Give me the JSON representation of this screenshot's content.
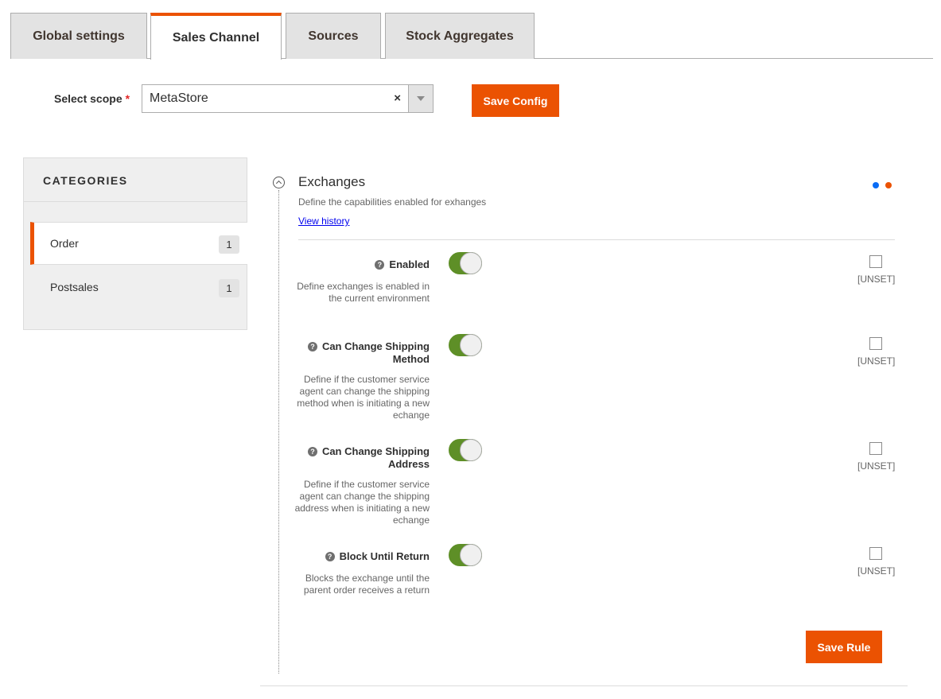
{
  "tabs": [
    {
      "label": "Global settings",
      "active": false
    },
    {
      "label": "Sales Channel",
      "active": true
    },
    {
      "label": "Sources",
      "active": false
    },
    {
      "label": "Stock Aggregates",
      "active": false
    }
  ],
  "scope": {
    "label": "Select scope",
    "required_marker": "*",
    "value": "MetaStore",
    "clear_symbol": "×"
  },
  "save_config_label": "Save Config",
  "sidebar": {
    "title": "CATEGORIES",
    "items": [
      {
        "label": "Order",
        "count": "1",
        "active": true
      },
      {
        "label": "Postsales",
        "count": "1",
        "active": false
      }
    ]
  },
  "section": {
    "title": "Exchanges",
    "description": "Define the capabilities enabled for exhanges",
    "view_history": "View history",
    "status_dots": {
      "blue": "#0a6cf5",
      "orange": "#eb5202"
    },
    "fields": [
      {
        "label": "Enabled",
        "description": "Define exchanges is enabled in the current environment",
        "enabled": true,
        "unset_label": "[UNSET]",
        "unset_checked": false
      },
      {
        "label": "Can Change Shipping Method",
        "description": "Define if the customer service agent can change the shipping method when is initiating a new echange",
        "enabled": true,
        "unset_label": "[UNSET]",
        "unset_checked": false
      },
      {
        "label": "Can Change Shipping Address",
        "description": "Define if the customer service agent can change the shipping address when is initiating a new echange",
        "enabled": true,
        "unset_label": "[UNSET]",
        "unset_checked": false
      },
      {
        "label": "Block Until Return",
        "description": "Blocks the exchange until the parent order receives a return",
        "enabled": true,
        "unset_label": "[UNSET]",
        "unset_checked": false
      }
    ],
    "help_symbol": "?",
    "save_rule_label": "Save Rule"
  },
  "colors": {
    "accent": "#eb5202",
    "toggle_on": "#5e8f27",
    "link": "#0000ee"
  }
}
